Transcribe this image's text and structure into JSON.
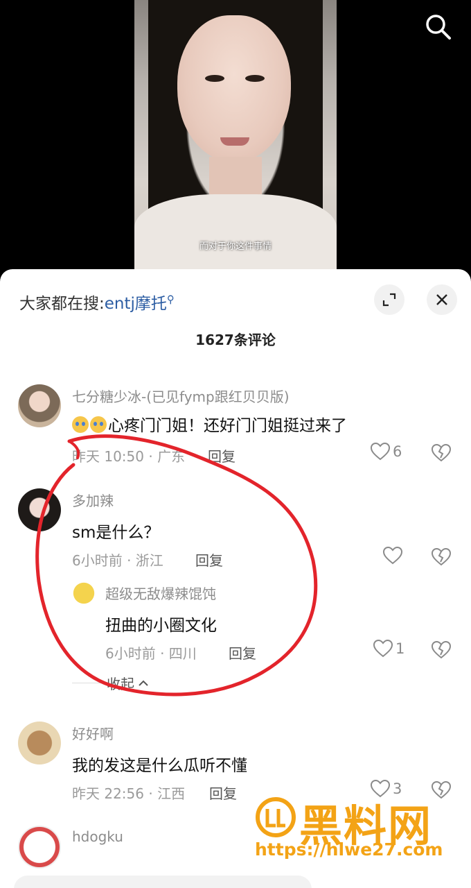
{
  "video": {
    "subtitle": "而对于你这件事情"
  },
  "header": {
    "hot_search_prefix": "大家都在搜:",
    "hot_search_keyword": "entj摩托",
    "comment_count": "1627条评论"
  },
  "comments": [
    {
      "username": "七分糖少冰-(已见fymp跟红贝贝版)",
      "text": "心疼门门姐！还好门门姐挺过来了",
      "time_location": "昨天 10:50 · 广东",
      "reply_label": "回复",
      "likes": "6"
    },
    {
      "username": "多加辣",
      "text": "sm是什么？",
      "time_location": "6小时前 · 浙江",
      "reply_label": "回复",
      "likes": ""
    },
    {
      "username": "好好啊",
      "text": "我的发这是什么瓜听不懂",
      "time_location": "昨天 22:56 · 江西",
      "reply_label": "回复",
      "likes": "3"
    },
    {
      "username": "hdogku",
      "text": "",
      "time_location": "",
      "reply_label": "",
      "likes": ""
    }
  ],
  "sub_reply": {
    "username": "超级无敌爆辣馄饨",
    "text": "扭曲的小圈文化",
    "time_location": "6小时前 · 四川",
    "reply_label": "回复",
    "likes": "1"
  },
  "collapse_label": "收起",
  "watermark": {
    "title": "黑料网",
    "url": "https://hlwe27.com"
  },
  "colors": {
    "link": "#2c5da3",
    "annotation": "#e3242b",
    "watermark": "#f3a316"
  }
}
